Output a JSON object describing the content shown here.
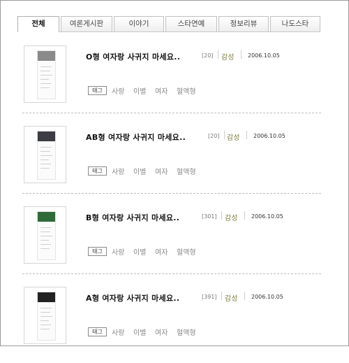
{
  "tabs": [
    {
      "label": "전체",
      "active": true
    },
    {
      "label": "여론게시판",
      "active": false
    },
    {
      "label": "이야기",
      "active": false
    },
    {
      "label": "스타연예",
      "active": false
    },
    {
      "label": "정보리뷰",
      "active": false
    },
    {
      "label": "나도스타",
      "active": false
    }
  ],
  "posts": [
    {
      "title": "O형 여자랑 사귀지 마세요..",
      "count": "[20]",
      "category": "감성",
      "date": "2006.10.05",
      "tag_label": "태그",
      "tags": [
        "사랑",
        "이별",
        "여자",
        "혈액형"
      ],
      "photo_color": "#8a8a8a"
    },
    {
      "title": "AB형 여자랑 사귀지 마세요..",
      "count": "[20]",
      "category": "감성",
      "date": "2006.10.05",
      "tag_label": "태그",
      "tags": [
        "사랑",
        "이별",
        "여자",
        "혈액형"
      ],
      "photo_color": "#3c3c44"
    },
    {
      "title": "B형 여자랑 사귀지 마세요..",
      "count": "[301]",
      "category": "감성",
      "date": "2006.10.05",
      "tag_label": "태그",
      "tags": [
        "사랑",
        "이별",
        "여자",
        "혈액형"
      ],
      "photo_color": "#2f6a3a"
    },
    {
      "title": "A형 여자랑 사귀지 마세요..",
      "count": "[391]",
      "category": "감성",
      "date": "2006.10.05",
      "tag_label": "태그",
      "tags": [
        "사랑",
        "이별",
        "여자",
        "혈액형"
      ],
      "photo_color": "#222222"
    }
  ]
}
